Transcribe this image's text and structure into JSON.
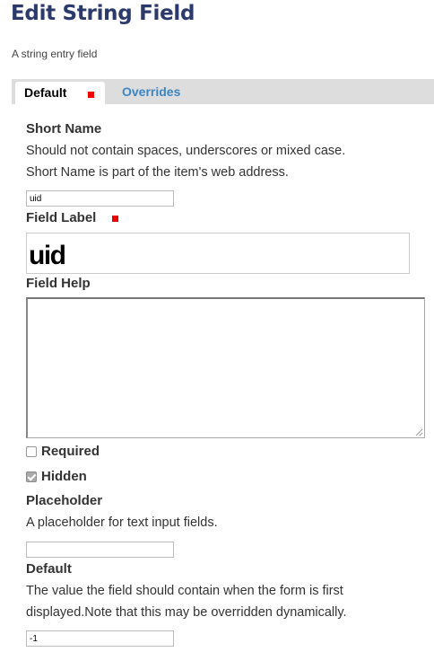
{
  "page": {
    "title": "Edit String Field",
    "description": "A string entry field"
  },
  "tabs": [
    {
      "label": "Default",
      "active": true,
      "required": true
    },
    {
      "label": "Overrides",
      "active": false
    }
  ],
  "fields": {
    "short_name": {
      "label": "Short Name",
      "help_line1": "Should not contain spaces, underscores or mixed case.",
      "help_line2": "Short Name is part of the item's web address.",
      "value": "uid"
    },
    "field_label": {
      "label": "Field Label",
      "required": true,
      "value": "uid"
    },
    "field_help": {
      "label": "Field Help",
      "value": ""
    },
    "required": {
      "label": "Required",
      "checked": false
    },
    "hidden": {
      "label": "Hidden",
      "checked": true
    },
    "placeholder": {
      "label": "Placeholder",
      "help": "A placeholder for text input fields.",
      "value": ""
    },
    "default": {
      "label": "Default",
      "help_line1": "The value the field should contain when the form is first",
      "help_line2": "displayed.Note that this may be overridden dynamically.",
      "value": "-1"
    }
  },
  "colors": {
    "title": "#2b3a6b",
    "tab_bar": "#dddddd",
    "tab_link": "#3b86c4",
    "required_marker": "#ee0000"
  }
}
